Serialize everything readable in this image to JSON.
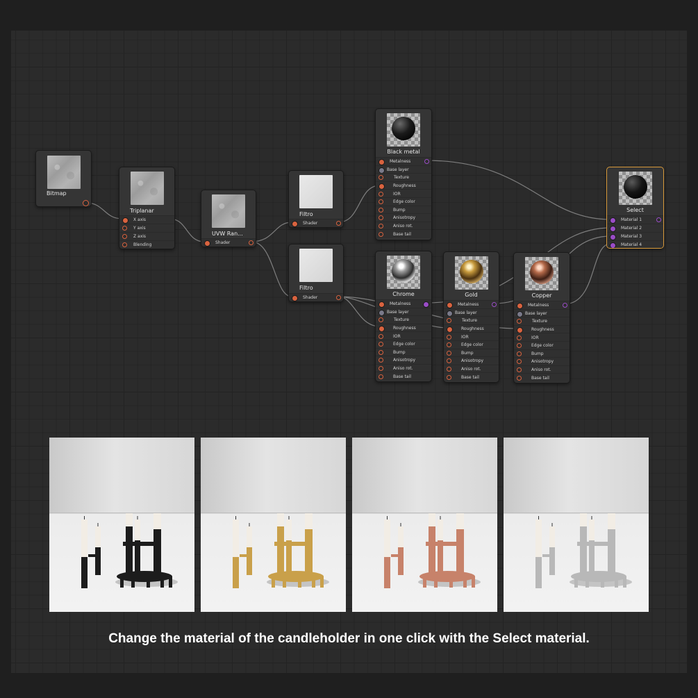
{
  "nodes": {
    "bitmap": {
      "title": "Bitmap"
    },
    "triplanar": {
      "title": "Triplanar",
      "inputs": [
        "X axis",
        "Y axis",
        "Z axis",
        "Blending"
      ]
    },
    "uvw": {
      "title": "UVW Ran...",
      "output": "Shader"
    },
    "filtro_top": {
      "title": "Filtro",
      "output": "Shader"
    },
    "filtro_bottom": {
      "title": "Filtro",
      "output": "Shader"
    },
    "black_metal": {
      "title": "Black metal"
    },
    "chrome": {
      "title": "Chrome"
    },
    "gold": {
      "title": "Gold"
    },
    "copper": {
      "title": "Copper"
    },
    "select": {
      "title": "Select",
      "inputs": [
        "Material 1",
        "Material 2",
        "Material 3",
        "Material 4"
      ]
    }
  },
  "material_inputs": [
    "Metalness",
    "Base layer",
    "Texture",
    "Roughness",
    "IOR",
    "Edge color",
    "Bump",
    "Anisotropy",
    "Aniso rot.",
    "Base tail"
  ],
  "previews": [
    {
      "material": "black",
      "metal_color": "#1c1c1c"
    },
    {
      "material": "gold",
      "metal_color": "#c9a04a"
    },
    {
      "material": "copper",
      "metal_color": "#c7826a"
    },
    {
      "material": "chrome",
      "metal_color": "#b8b8b8"
    }
  ],
  "caption": "Change the material of the candleholder in one click with the Select material.",
  "colors": {
    "accent_selected": "#d99b3c",
    "port_orange": "#d9633f",
    "port_purple": "#9a4dc7"
  }
}
